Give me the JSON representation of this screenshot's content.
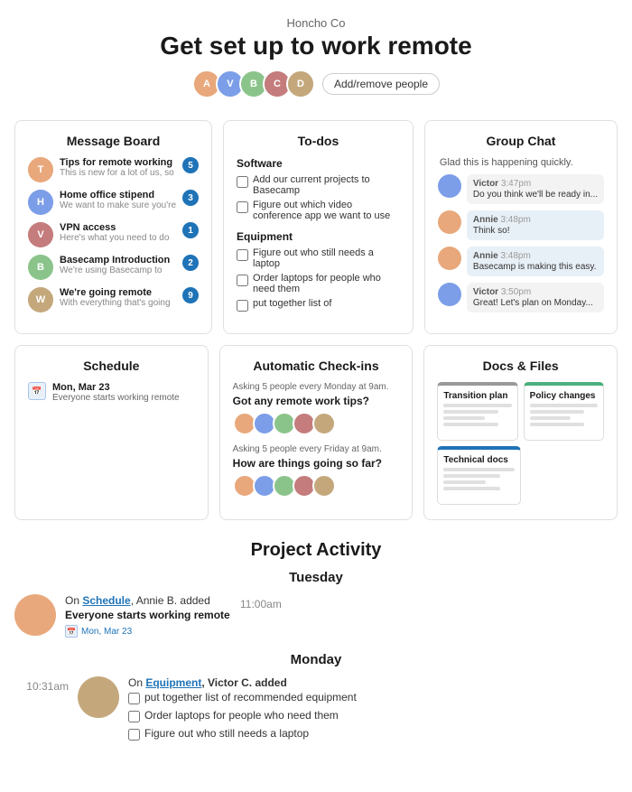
{
  "header": {
    "company": "Honcho Co",
    "title": "Get set up to work remote",
    "add_people_label": "Add/remove people"
  },
  "people": [
    {
      "initials": "A",
      "color": "#e8a87c"
    },
    {
      "initials": "V",
      "color": "#7c9ee8"
    },
    {
      "initials": "B",
      "color": "#8bc48b"
    },
    {
      "initials": "C",
      "color": "#c47c7c"
    },
    {
      "initials": "D",
      "color": "#c4a87c"
    }
  ],
  "message_board": {
    "title": "Message Board",
    "items": [
      {
        "title": "Tips for remote working",
        "sub": "This is new for a lot of us, so",
        "badge": "5",
        "avatar_color": "#e8a87c"
      },
      {
        "title": "Home office stipend",
        "sub": "We want to make sure you're",
        "badge": "3",
        "avatar_color": "#7c9ee8"
      },
      {
        "title": "VPN access",
        "sub": "Here's what you need to do",
        "badge": "1",
        "avatar_color": "#c47c7c"
      },
      {
        "title": "Basecamp Introduction",
        "sub": "We're using Basecamp to",
        "badge": "2",
        "avatar_color": "#8bc48b"
      },
      {
        "title": "We're going remote",
        "sub": "With everything that's going",
        "badge": "9",
        "avatar_color": "#c4a87c"
      }
    ]
  },
  "todos": {
    "title": "To-dos",
    "groups": [
      {
        "name": "Software",
        "items": [
          "Add our current projects to Basecamp",
          "Figure out which video conference app we want to use"
        ]
      },
      {
        "name": "Equipment",
        "items": [
          "Figure out who still needs a laptop",
          "Order laptops for people who need them",
          "put together list of"
        ]
      }
    ]
  },
  "group_chat": {
    "title": "Group Chat",
    "messages": [
      {
        "author": "",
        "time": "",
        "text": "Glad this is happening quickly.",
        "avatar_color": "#e8a87c",
        "highlighted": false,
        "first": true
      },
      {
        "author": "Victor",
        "time": "3:47pm",
        "text": "Do you think we'll be ready in...",
        "avatar_color": "#7c9ee8",
        "highlighted": false
      },
      {
        "author": "Annie",
        "time": "3:48pm",
        "text": "Think so!",
        "avatar_color": "#e8a87c",
        "highlighted": true
      },
      {
        "author": "Annie",
        "time": "3:48pm",
        "text": "Basecamp is making this easy.",
        "avatar_color": "#e8a87c",
        "highlighted": true
      },
      {
        "author": "Victor",
        "time": "3:50pm",
        "text": "Great! Let's plan on Monday...",
        "avatar_color": "#7c9ee8",
        "highlighted": false
      }
    ]
  },
  "schedule": {
    "title": "Schedule",
    "items": [
      {
        "date": "Mon, Mar 23",
        "description": "Everyone starts working remote"
      }
    ]
  },
  "checkins": {
    "title": "Automatic Check-ins",
    "groups": [
      {
        "label": "Asking 5 people every Monday at 9am.",
        "question": "Got any remote work tips?"
      },
      {
        "label": "Asking 5 people every Friday at 9am.",
        "question": "How are things going so far?"
      }
    ]
  },
  "docs": {
    "title": "Docs & Files",
    "files": [
      {
        "name": "Transition plan",
        "color": "gray"
      },
      {
        "name": "Policy changes",
        "color": "green"
      },
      {
        "name": "Technical docs",
        "color": "blue"
      }
    ]
  },
  "project_activity": {
    "title": "Project Activity",
    "days": [
      {
        "label": "Tuesday",
        "time": "11:00am",
        "events": [
          {
            "avatar_color": "#e8a87c",
            "desc_pre": "On ",
            "desc_link": "Schedule",
            "desc_post": ", Annie B. added",
            "event": "Everyone starts working remote",
            "badge_label": "Mon, Mar 23",
            "side": "left"
          }
        ]
      },
      {
        "label": "Monday",
        "time": "10:31am",
        "events": [
          {
            "avatar_color": "#c4a87c",
            "desc_pre": "On ",
            "desc_link": "Equipment",
            "desc_post": ", Victor C. added",
            "todos": [
              "put together list of recommended equipment",
              "Order laptops for people who need them",
              "Figure out who still needs a laptop"
            ],
            "side": "right"
          }
        ]
      }
    ]
  }
}
